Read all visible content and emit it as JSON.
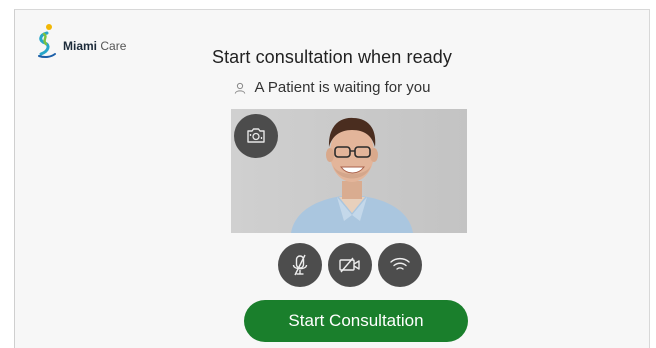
{
  "logo": {
    "brand_bold": "Miami",
    "brand_light": "Care",
    "icon": "miami-care-logo-icon"
  },
  "header": {
    "title": "Start consultation when ready",
    "waiting_text": "A Patient is waiting for you",
    "waiting_icon": "user-icon"
  },
  "video": {
    "flip_icon": "camera-flip-icon"
  },
  "controls": {
    "mute_icon": "microphone-muted-icon",
    "camera_icon": "camera-off-icon",
    "network_icon": "wifi-icon"
  },
  "actions": {
    "start_label": "Start Consultation"
  },
  "colors": {
    "accent": "#1a7f2c",
    "control_bg": "#4d4d4d",
    "background": "#f7f7f7"
  }
}
